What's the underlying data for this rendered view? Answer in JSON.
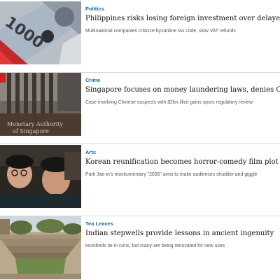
{
  "articles": [
    {
      "category": "Politics",
      "headline": "Philippines risks losing foreign investment over delayed tax rebates",
      "summary": "Multinational companies criticize byzantine tax code, slow VAT refunds",
      "image": "peso-banknotes-image"
    },
    {
      "category": "Crime",
      "headline": "Singapore focuses on money laundering laws, denies China pressure",
      "summary": "Case involving Chinese suspects with $2bn illicit gains spurs regulatory review",
      "image": "singapore-building-image"
    },
    {
      "category": "Arts",
      "headline": "Korean reunification becomes horror-comedy film plot",
      "summary": "Park Jae-in's mockumentary \"2035\" aims to make audiences shudder and giggle",
      "image": "film-still-image"
    },
    {
      "category": "Tea Leaves",
      "headline": "Indian stepwells provide lessons in ancient ingenuity",
      "summary": "Hundreds lie in ruins, but many are being renovated for new uses",
      "image": "stepwell-image"
    }
  ],
  "colors": {
    "category": "#1a6aa8",
    "headline": "#111111",
    "summary": "#555555",
    "divider": "#d8d8d8"
  }
}
